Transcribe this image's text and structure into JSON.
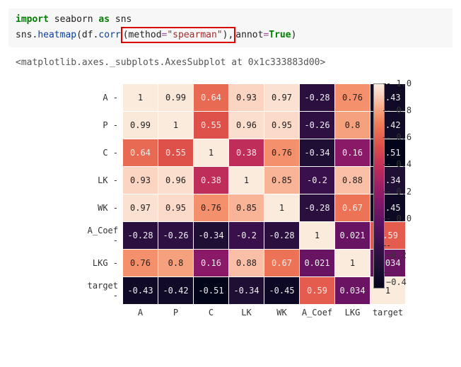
{
  "code": {
    "line1_import": "import",
    "line1_seaborn": "seaborn",
    "line1_as": "as",
    "line1_sns": "sns",
    "line2_pre": "sns.",
    "line2_heatmap": "heatmap",
    "line2_open": "(df.",
    "line2_corr": "corr",
    "line2_boxed_open": "(method",
    "line2_eq": "=",
    "line2_str": "\"spearman\"",
    "line2_boxed_close": "),",
    "line2_annot": "annot",
    "line2_eq2": "=",
    "line2_true": "True",
    "line2_close": ")"
  },
  "output_repr": "<matplotlib.axes._subplots.AxesSubplot at 0x1c333883d00>",
  "chart_data": {
    "type": "heatmap",
    "title": "",
    "xlabel": "",
    "ylabel": "",
    "categories": [
      "A",
      "P",
      "C",
      "LK",
      "WK",
      "A_Coef",
      "LKG",
      "target"
    ],
    "matrix": [
      [
        1,
        0.99,
        0.64,
        0.93,
        0.97,
        -0.28,
        0.76,
        -0.43
      ],
      [
        0.99,
        1,
        0.55,
        0.96,
        0.95,
        -0.26,
        0.8,
        -0.42
      ],
      [
        0.64,
        0.55,
        1,
        0.38,
        0.76,
        -0.34,
        0.16,
        -0.51
      ],
      [
        0.93,
        0.96,
        0.38,
        1,
        0.85,
        -0.2,
        0.88,
        -0.34
      ],
      [
        0.97,
        0.95,
        0.76,
        0.85,
        1,
        -0.28,
        0.67,
        -0.45
      ],
      [
        -0.28,
        -0.26,
        -0.34,
        -0.2,
        -0.28,
        1,
        0.021,
        0.59
      ],
      [
        0.76,
        0.8,
        0.16,
        0.88,
        0.67,
        0.021,
        1,
        0.034
      ],
      [
        -0.43,
        -0.42,
        -0.51,
        -0.34,
        -0.45,
        0.59,
        0.034,
        1
      ]
    ],
    "colorbar": {
      "min": -0.51,
      "max": 1.0,
      "ticks": [
        1.0,
        0.8,
        0.6,
        0.4,
        0.2,
        0.0,
        -0.2,
        -0.4
      ],
      "tick_labels": [
        "1.0",
        "0.8",
        "0.6",
        "0.4",
        "0.2",
        "0.0",
        "−0.2",
        "−0.4"
      ]
    }
  }
}
